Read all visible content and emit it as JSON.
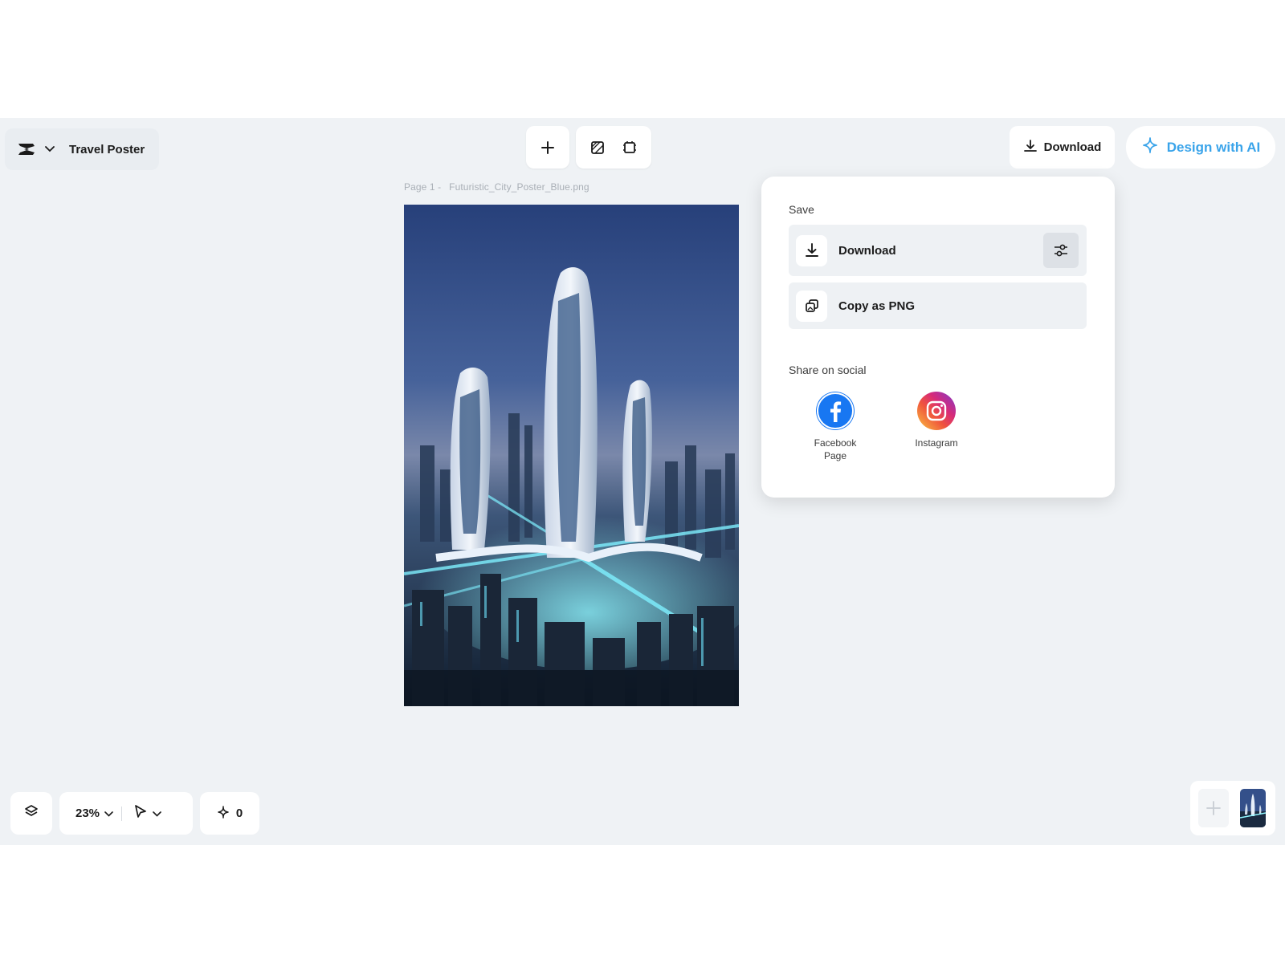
{
  "header": {
    "doc_title": "Travel Poster",
    "download_label": "Download",
    "design_ai_label": "Design with AI"
  },
  "canvas": {
    "page_label": "Page 1 -",
    "file_name": "Futuristic_City_Poster_Blue.png"
  },
  "save_panel": {
    "save_heading": "Save",
    "download_label": "Download",
    "copy_label": "Copy as PNG",
    "share_heading": "Share on social",
    "social": [
      {
        "label": "Facebook Page",
        "icon": "facebook-icon"
      },
      {
        "label": "Instagram",
        "icon": "instagram-icon"
      }
    ]
  },
  "bottom_bar": {
    "zoom": "23%",
    "ai_credits": "0"
  },
  "colors": {
    "accent": "#3aa4ea",
    "canvas_bg": "#eff2f5",
    "facebook": "#1877f2"
  }
}
